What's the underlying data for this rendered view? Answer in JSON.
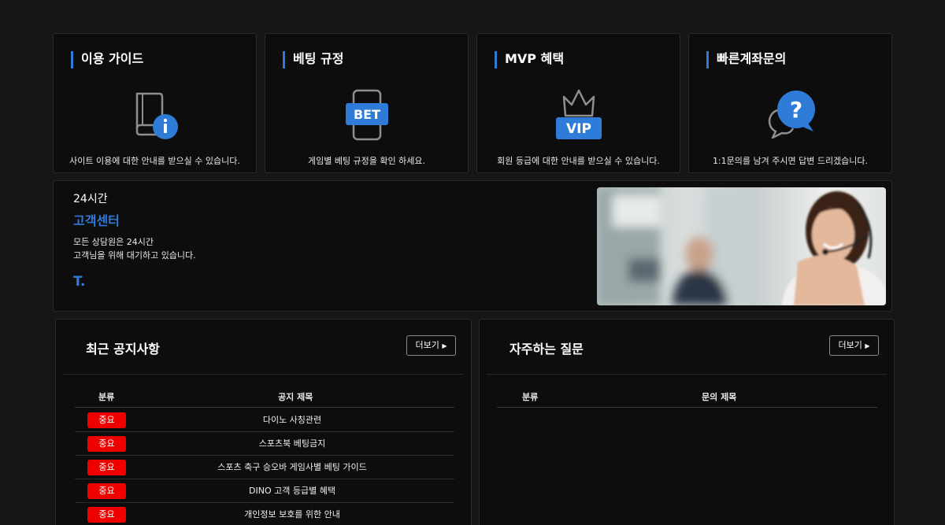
{
  "cards": [
    {
      "title": "이용 가이드",
      "icon": "guide-book-icon",
      "desc": "사이트 이용에 대한 안내를 받으실 수 있습니다."
    },
    {
      "title": "베팅 규정",
      "icon": "bet-phone-icon",
      "icon_text": "BET",
      "desc": "게임별 베팅 규정을 확인 하세요."
    },
    {
      "title": "MVP 혜택",
      "icon": "vip-crown-icon",
      "icon_text": "VIP",
      "desc": "회원 등급에 대한 안내를 받으실 수 있습니다."
    },
    {
      "title": "빠른계좌문의",
      "icon": "question-chat-icon",
      "icon_text": "?",
      "desc": "1:1문의를 남겨 주시면 답변 드리겠습니다."
    }
  ],
  "customer_service": {
    "hours": "24시간",
    "title": "고객센터",
    "desc_line1": "모든 상담원은 24시간",
    "desc_line2": "고객님을 위해 대기하고 있습니다.",
    "phone": "T."
  },
  "notices": {
    "title": "최근 공지사항",
    "more_label": "더보기",
    "col_category": "분류",
    "col_title": "공지 제목",
    "rows": [
      {
        "badge": "중요",
        "title": "다이노 사칭관련"
      },
      {
        "badge": "중요",
        "title": "스포츠북 베팅금지"
      },
      {
        "badge": "중요",
        "title": "스포츠 축구 승오바 게임사별 베팅 가이드"
      },
      {
        "badge": "중요",
        "title": "DINO 고객 등급별 혜택"
      },
      {
        "badge": "중요",
        "title": "개인정보 보호를 위한 안내"
      }
    ]
  },
  "faq": {
    "title": "자주하는 질문",
    "more_label": "더보기",
    "col_category": "분류",
    "col_title": "문의 제목"
  },
  "colors": {
    "accent": "#2f7bd8",
    "badge": "#ee0000",
    "background": "#161616",
    "panel": "#0d0d0d"
  }
}
